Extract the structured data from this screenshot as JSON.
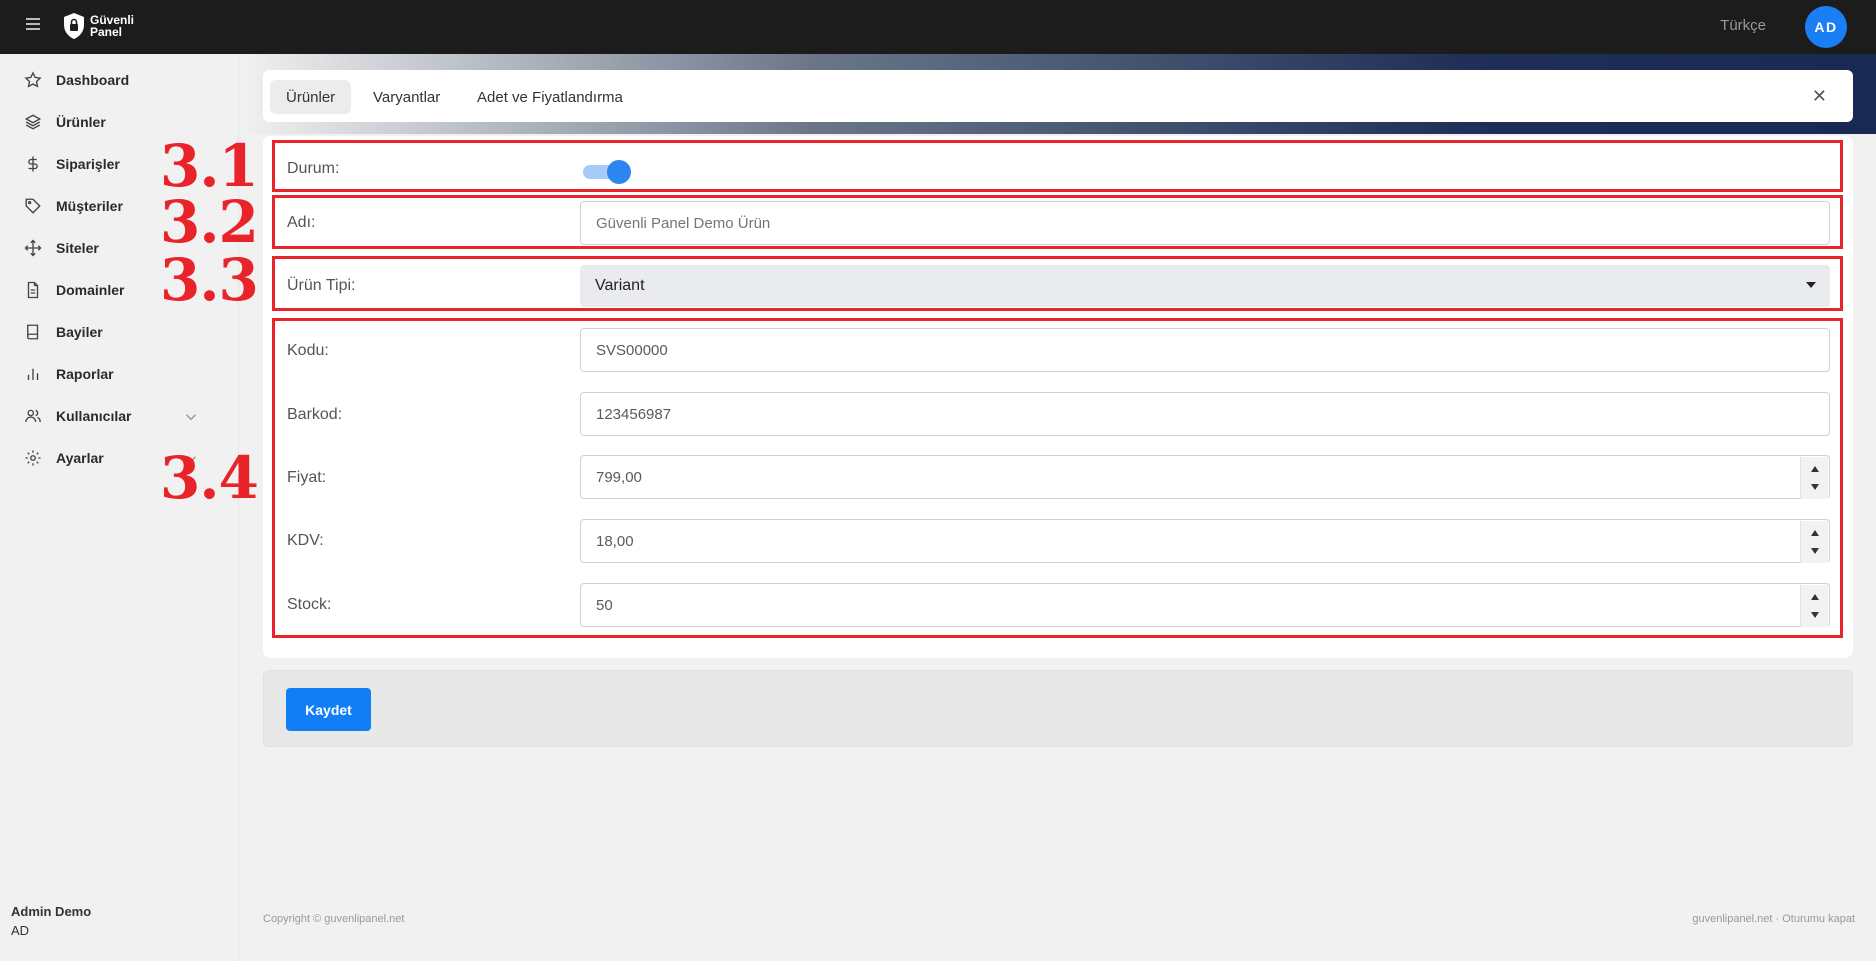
{
  "topbar": {
    "logo_line1": "Güvenli",
    "logo_line2": "Panel",
    "language": "Türkçe",
    "avatar_initials": "AD"
  },
  "sidebar": {
    "items": [
      {
        "label": "Dashboard",
        "icon": "star-icon"
      },
      {
        "label": "Ürünler",
        "icon": "layers-icon"
      },
      {
        "label": "Siparişler",
        "icon": "dollar-icon"
      },
      {
        "label": "Müşteriler",
        "icon": "tag-icon"
      },
      {
        "label": "Siteler",
        "icon": "move-icon"
      },
      {
        "label": "Domainler",
        "icon": "file-icon"
      },
      {
        "label": "Bayiler",
        "icon": "book-icon"
      },
      {
        "label": "Raporlar",
        "icon": "bar-chart-icon"
      },
      {
        "label": "Kullanıcılar",
        "icon": "users-icon"
      },
      {
        "label": "Ayarlar",
        "icon": "gear-icon"
      }
    ],
    "user_name": "Admin Demo",
    "user_initials": "AD"
  },
  "annotations": [
    "3.1",
    "3.2",
    "3.3",
    "3.4"
  ],
  "tabs": [
    {
      "label": "Ürünler",
      "active": true
    },
    {
      "label": "Varyantlar",
      "active": false
    },
    {
      "label": "Adet ve Fiyatlandırma",
      "active": false
    }
  ],
  "form": {
    "status_label": "Durum:",
    "status_on": true,
    "name_label": "Adı:",
    "name_placeholder": "Güvenli Panel Demo Ürün",
    "type_label": "Ürün Tipi:",
    "type_value": "Variant",
    "code_label": "Kodu:",
    "code_value": "SVS00000",
    "barcode_label": "Barkod:",
    "barcode_value": "123456987",
    "price_label": "Fiyat:",
    "price_value": "799,00",
    "vat_label": "KDV:",
    "vat_value": "18,00",
    "stock_label": "Stock:",
    "stock_value": "50"
  },
  "actions": {
    "save_label": "Kaydet"
  },
  "footer": {
    "copyright": "Copyright © guvenlipanel.net",
    "right_text": "guvenlipanel.net · Oturumu kapat"
  },
  "colors": {
    "accent": "#127ef5",
    "annotation": "#e8232a",
    "topbar": "#1c1c1c"
  }
}
